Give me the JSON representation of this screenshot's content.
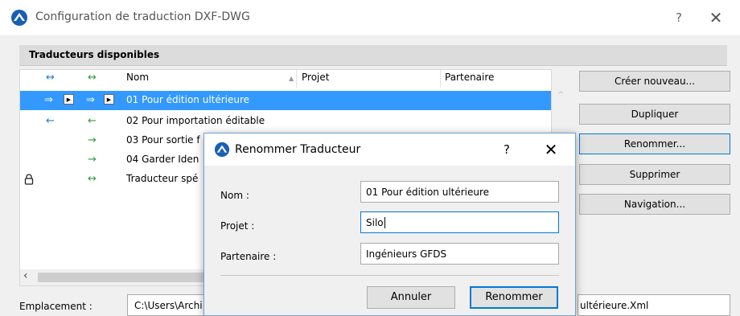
{
  "window": {
    "title": "Configuration de traduction DXF-DWG",
    "help_glyph": "?",
    "close_glyph": "✕",
    "icon": "archicad-logo-icon"
  },
  "section": {
    "title": "Traducteurs disponibles"
  },
  "list": {
    "headers": {
      "col_arrow1": "↔",
      "col_arrow2": "↔",
      "name": "Nom",
      "sort_indicator": "▲",
      "project": "Projet",
      "partner": "Partenaire"
    },
    "rows": [
      {
        "lock": "",
        "arrow1": "⇒",
        "arrow2": "⇒",
        "name": "01 Pour édition ultérieure",
        "selected": true
      },
      {
        "lock": "",
        "arrow1": "←",
        "arrow2": "←",
        "name": "02 Pour importation éditable",
        "selected": false
      },
      {
        "lock": "",
        "arrow1": "",
        "arrow2": "→",
        "name": "03 Pour sortie f",
        "selected": false
      },
      {
        "lock": "",
        "arrow1": "",
        "arrow2": "→",
        "name": "04 Garder Iden",
        "selected": false
      },
      {
        "lock": "🔒",
        "arrow1": "",
        "arrow2": "↔",
        "name": "Traducteur spé",
        "selected": false
      }
    ],
    "play_glyph": "▶",
    "scroll_left_glyph": "‹",
    "scroll_up_glyph": "^"
  },
  "buttons": {
    "create": "Créer nouveau...",
    "duplicate": "Dupliquer",
    "rename": "Renommer...",
    "delete": "Supprimer",
    "navigation": "Navigation..."
  },
  "location": {
    "label": "Emplacement :",
    "path_start": "C:\\Users\\Archi",
    "path_end": "ultérieure.Xml"
  },
  "dialog": {
    "title": "Renommer Traducteur",
    "help_glyph": "?",
    "close_glyph": "✕",
    "name_label": "Nom :",
    "name_value": "01 Pour édition ultérieure",
    "project_label": "Projet :",
    "project_value": "Silo",
    "partner_label": "Partenaire :",
    "partner_value": "Ingénieurs GFDS",
    "cancel": "Annuler",
    "ok": "Renommer"
  },
  "colors": {
    "accent": "#0078d7",
    "selection": "#3399ff",
    "arrow_blue": "#1e7fd0",
    "arrow_green": "#2e9d3a"
  }
}
